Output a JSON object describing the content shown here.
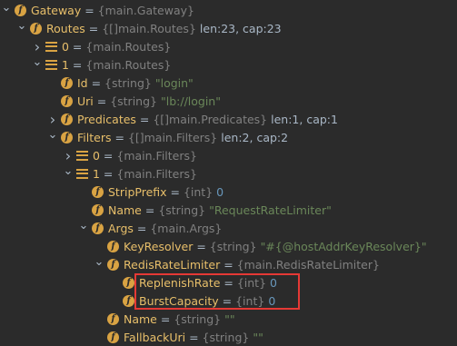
{
  "rows": [
    {
      "arrow": "v",
      "icon": "f",
      "name": "Gateway",
      "type": "{main.Gateway}",
      "value": "",
      "vclass": "",
      "depth": 0
    },
    {
      "arrow": "v",
      "icon": "f",
      "name": "Routes",
      "type": "{[]main.Routes}",
      "value": "len:23, cap:23",
      "vclass": "val-plain",
      "depth": 1
    },
    {
      "arrow": ">",
      "icon": "list",
      "name": "0",
      "type": "{main.Routes}",
      "value": "",
      "vclass": "",
      "depth": 2
    },
    {
      "arrow": "v",
      "icon": "list",
      "name": "1",
      "type": "{main.Routes}",
      "value": "",
      "vclass": "",
      "depth": 2
    },
    {
      "arrow": "",
      "icon": "f",
      "name": "Id",
      "type": "{string}",
      "value": "\"login\"",
      "vclass": "val-str",
      "depth": 3
    },
    {
      "arrow": "",
      "icon": "f",
      "name": "Uri",
      "type": "{string}",
      "value": "\"lb://login\"",
      "vclass": "val-str",
      "depth": 3
    },
    {
      "arrow": ">",
      "icon": "f",
      "name": "Predicates",
      "type": "{[]main.Predicates}",
      "value": "len:1, cap:1",
      "vclass": "val-plain",
      "depth": 3
    },
    {
      "arrow": "v",
      "icon": "f",
      "name": "Filters",
      "type": "{[]main.Filters}",
      "value": "len:2, cap:2",
      "vclass": "val-plain",
      "depth": 3
    },
    {
      "arrow": ">",
      "icon": "list",
      "name": "0",
      "type": "{main.Filters}",
      "value": "",
      "vclass": "",
      "depth": 4
    },
    {
      "arrow": "v",
      "icon": "list",
      "name": "1",
      "type": "{main.Filters}",
      "value": "",
      "vclass": "",
      "depth": 4
    },
    {
      "arrow": "",
      "icon": "f",
      "name": "StripPrefix",
      "type": "{int}",
      "value": "0",
      "vclass": "val-num",
      "depth": 5
    },
    {
      "arrow": "",
      "icon": "f",
      "name": "Name",
      "type": "{string}",
      "value": "\"RequestRateLimiter\"",
      "vclass": "val-str",
      "depth": 5
    },
    {
      "arrow": "v",
      "icon": "f",
      "name": "Args",
      "type": "{main.Args}",
      "value": "",
      "vclass": "",
      "depth": 5
    },
    {
      "arrow": "",
      "icon": "f",
      "name": "KeyResolver",
      "type": "{string}",
      "value": "\"#{@hostAddrKeyResolver}\"",
      "vclass": "val-str",
      "depth": 6
    },
    {
      "arrow": "v",
      "icon": "f",
      "name": "RedisRateLimiter",
      "type": "{main.RedisRateLimiter}",
      "value": "",
      "vclass": "",
      "depth": 6
    },
    {
      "arrow": "",
      "icon": "f",
      "name": "ReplenishRate",
      "type": "{int}",
      "value": "0",
      "vclass": "val-num",
      "depth": 7
    },
    {
      "arrow": "",
      "icon": "f",
      "name": "BurstCapacity",
      "type": "{int}",
      "value": "0",
      "vclass": "val-num",
      "depth": 7
    },
    {
      "arrow": "",
      "icon": "f",
      "name": "Name",
      "type": "{string}",
      "value": "\"\"",
      "vclass": "val-str",
      "depth": 6
    },
    {
      "arrow": "",
      "icon": "f",
      "name": "FallbackUri",
      "type": "{string}",
      "value": "\"\"",
      "vclass": "val-str",
      "depth": 6
    }
  ],
  "eq_sign": "=",
  "icon_letter": "f"
}
